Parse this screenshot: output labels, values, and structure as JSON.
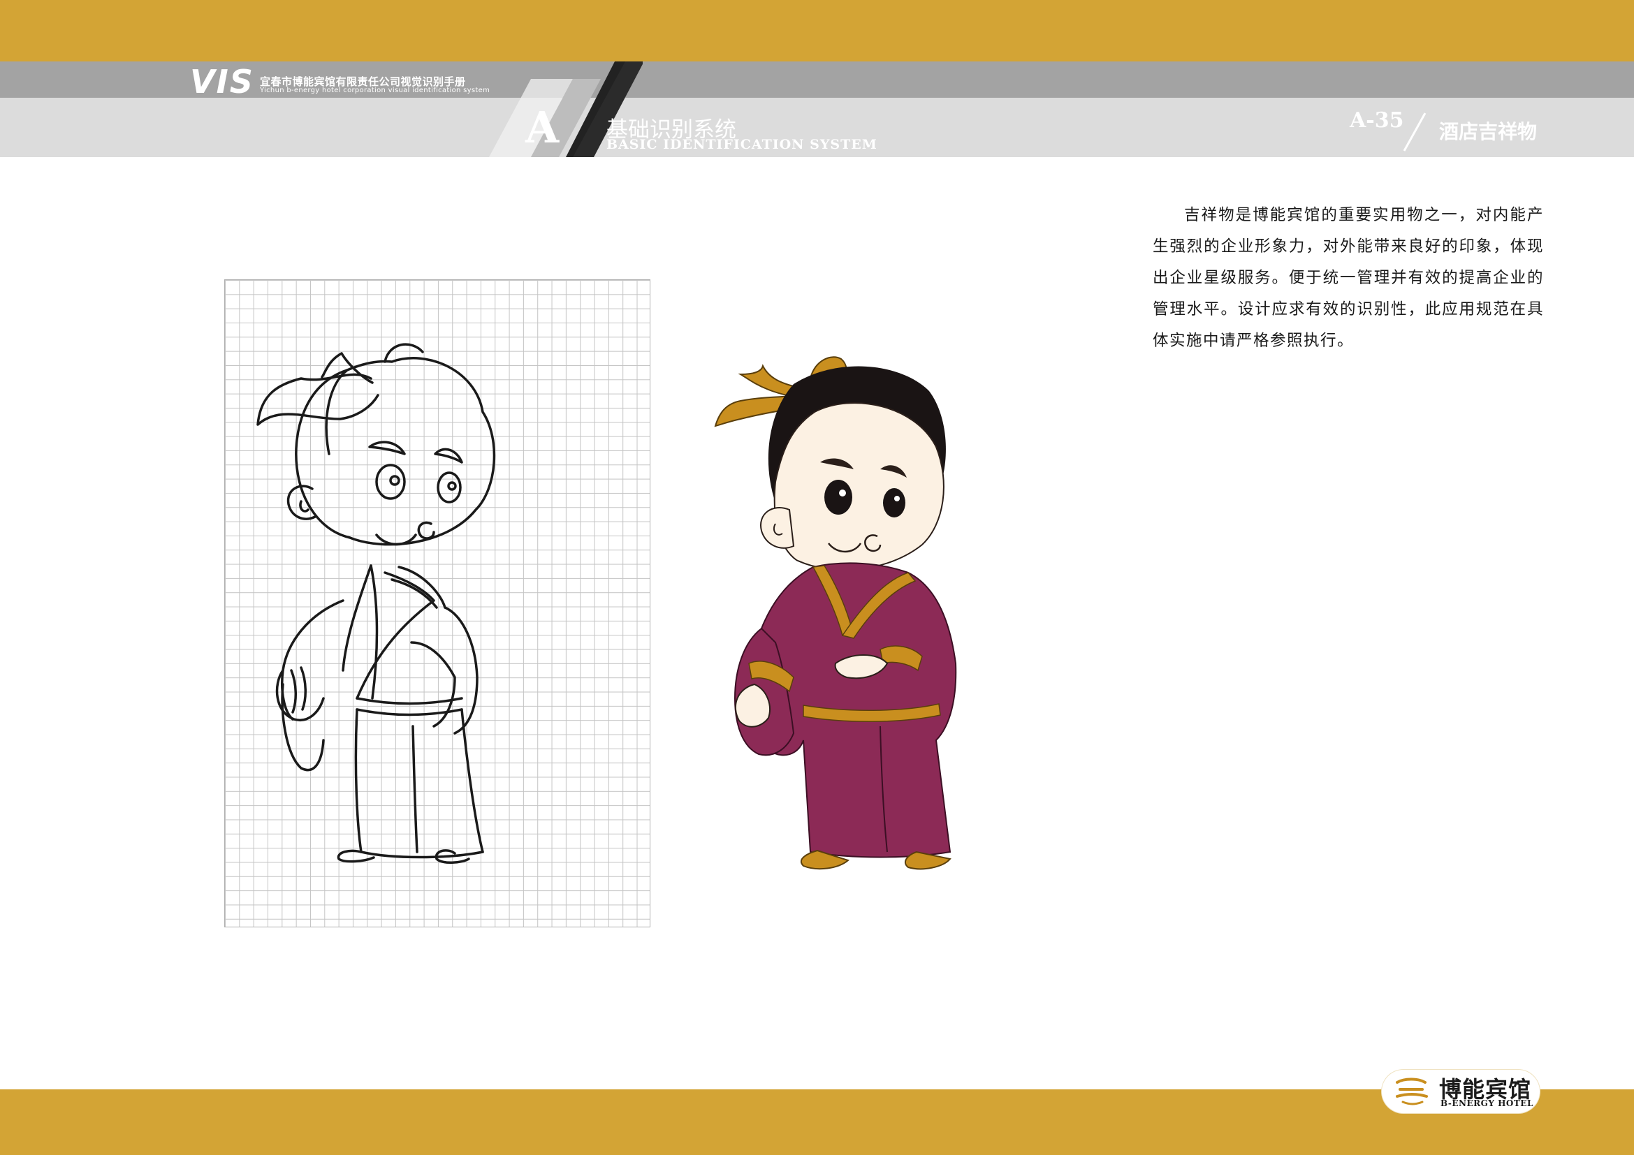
{
  "header": {
    "vis_mark": "VIS",
    "manual_title_cn": "宜春市博能宾馆有限责任公司视觉识别手册",
    "manual_title_en": "Yichun b-energy hotel corporation visual identification system",
    "section_letter": "A",
    "section_title_cn": "基础识别系统",
    "section_title_en": "BASIC IDENTIFICATION SYSTEM",
    "page_number": "A-35",
    "page_topic": "酒店吉祥物"
  },
  "intro_text": "吉祥物是博能宾馆的重要实用物之一，对内能产生强烈的企业形象力，对外能带来良好的印象，体现出企业星级服务。便于统一管理并有效的提高企业的管理水平。设计应求有效的识别性，此应用规范在具体实施中请严格参照执行。",
  "footer": {
    "hotel_name_cn": "博能宾馆",
    "hotel_name_en": "B-ENERGY HOTEL"
  },
  "colors": {
    "gold": "#d3a435",
    "grey_dark": "#a3a3a3",
    "grey_light": "#dcdcdc",
    "robe_purple": "#8c2a56",
    "trim_gold": "#c98f1f",
    "hair_black": "#1a1414",
    "skin": "#fcf1e3"
  },
  "icons": {
    "header_slash": "diagonal-stripes",
    "hotel_logo": "b-energy-emblem-icon"
  }
}
